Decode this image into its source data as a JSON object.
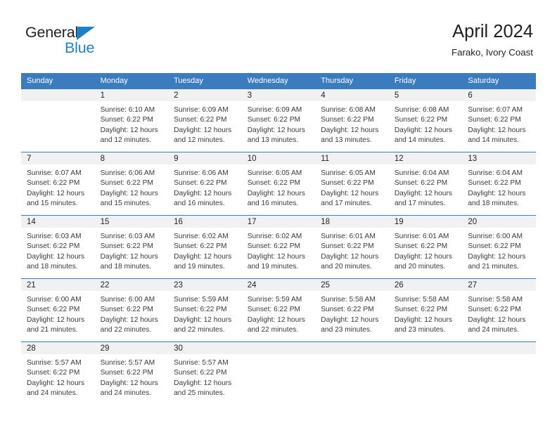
{
  "logo": {
    "word_dark": "General",
    "word_blue": "Blue",
    "triangle_color": "#1f7fc4"
  },
  "header": {
    "title": "April 2024",
    "subtitle": "Farako, Ivory Coast"
  },
  "theme": {
    "header_blue": "#3b7cbf",
    "daynum_band": "#f1f1f1",
    "text": "#231f20",
    "body_text": "#3a3a3a"
  },
  "calendar": {
    "weekday_headers": [
      "Sunday",
      "Monday",
      "Tuesday",
      "Wednesday",
      "Thursday",
      "Friday",
      "Saturday"
    ],
    "weeks": [
      [
        {
          "day": "",
          "lines": [
            "",
            "",
            "",
            ""
          ]
        },
        {
          "day": "1",
          "lines": [
            "Sunrise: 6:10 AM",
            "Sunset: 6:22 PM",
            "Daylight: 12 hours",
            "and 12 minutes."
          ]
        },
        {
          "day": "2",
          "lines": [
            "Sunrise: 6:09 AM",
            "Sunset: 6:22 PM",
            "Daylight: 12 hours",
            "and 12 minutes."
          ]
        },
        {
          "day": "3",
          "lines": [
            "Sunrise: 6:09 AM",
            "Sunset: 6:22 PM",
            "Daylight: 12 hours",
            "and 13 minutes."
          ]
        },
        {
          "day": "4",
          "lines": [
            "Sunrise: 6:08 AM",
            "Sunset: 6:22 PM",
            "Daylight: 12 hours",
            "and 13 minutes."
          ]
        },
        {
          "day": "5",
          "lines": [
            "Sunrise: 6:08 AM",
            "Sunset: 6:22 PM",
            "Daylight: 12 hours",
            "and 14 minutes."
          ]
        },
        {
          "day": "6",
          "lines": [
            "Sunrise: 6:07 AM",
            "Sunset: 6:22 PM",
            "Daylight: 12 hours",
            "and 14 minutes."
          ]
        }
      ],
      [
        {
          "day": "7",
          "lines": [
            "Sunrise: 6:07 AM",
            "Sunset: 6:22 PM",
            "Daylight: 12 hours",
            "and 15 minutes."
          ]
        },
        {
          "day": "8",
          "lines": [
            "Sunrise: 6:06 AM",
            "Sunset: 6:22 PM",
            "Daylight: 12 hours",
            "and 15 minutes."
          ]
        },
        {
          "day": "9",
          "lines": [
            "Sunrise: 6:06 AM",
            "Sunset: 6:22 PM",
            "Daylight: 12 hours",
            "and 16 minutes."
          ]
        },
        {
          "day": "10",
          "lines": [
            "Sunrise: 6:05 AM",
            "Sunset: 6:22 PM",
            "Daylight: 12 hours",
            "and 16 minutes."
          ]
        },
        {
          "day": "11",
          "lines": [
            "Sunrise: 6:05 AM",
            "Sunset: 6:22 PM",
            "Daylight: 12 hours",
            "and 17 minutes."
          ]
        },
        {
          "day": "12",
          "lines": [
            "Sunrise: 6:04 AM",
            "Sunset: 6:22 PM",
            "Daylight: 12 hours",
            "and 17 minutes."
          ]
        },
        {
          "day": "13",
          "lines": [
            "Sunrise: 6:04 AM",
            "Sunset: 6:22 PM",
            "Daylight: 12 hours",
            "and 18 minutes."
          ]
        }
      ],
      [
        {
          "day": "14",
          "lines": [
            "Sunrise: 6:03 AM",
            "Sunset: 6:22 PM",
            "Daylight: 12 hours",
            "and 18 minutes."
          ]
        },
        {
          "day": "15",
          "lines": [
            "Sunrise: 6:03 AM",
            "Sunset: 6:22 PM",
            "Daylight: 12 hours",
            "and 18 minutes."
          ]
        },
        {
          "day": "16",
          "lines": [
            "Sunrise: 6:02 AM",
            "Sunset: 6:22 PM",
            "Daylight: 12 hours",
            "and 19 minutes."
          ]
        },
        {
          "day": "17",
          "lines": [
            "Sunrise: 6:02 AM",
            "Sunset: 6:22 PM",
            "Daylight: 12 hours",
            "and 19 minutes."
          ]
        },
        {
          "day": "18",
          "lines": [
            "Sunrise: 6:01 AM",
            "Sunset: 6:22 PM",
            "Daylight: 12 hours",
            "and 20 minutes."
          ]
        },
        {
          "day": "19",
          "lines": [
            "Sunrise: 6:01 AM",
            "Sunset: 6:22 PM",
            "Daylight: 12 hours",
            "and 20 minutes."
          ]
        },
        {
          "day": "20",
          "lines": [
            "Sunrise: 6:00 AM",
            "Sunset: 6:22 PM",
            "Daylight: 12 hours",
            "and 21 minutes."
          ]
        }
      ],
      [
        {
          "day": "21",
          "lines": [
            "Sunrise: 6:00 AM",
            "Sunset: 6:22 PM",
            "Daylight: 12 hours",
            "and 21 minutes."
          ]
        },
        {
          "day": "22",
          "lines": [
            "Sunrise: 6:00 AM",
            "Sunset: 6:22 PM",
            "Daylight: 12 hours",
            "and 22 minutes."
          ]
        },
        {
          "day": "23",
          "lines": [
            "Sunrise: 5:59 AM",
            "Sunset: 6:22 PM",
            "Daylight: 12 hours",
            "and 22 minutes."
          ]
        },
        {
          "day": "24",
          "lines": [
            "Sunrise: 5:59 AM",
            "Sunset: 6:22 PM",
            "Daylight: 12 hours",
            "and 22 minutes."
          ]
        },
        {
          "day": "25",
          "lines": [
            "Sunrise: 5:58 AM",
            "Sunset: 6:22 PM",
            "Daylight: 12 hours",
            "and 23 minutes."
          ]
        },
        {
          "day": "26",
          "lines": [
            "Sunrise: 5:58 AM",
            "Sunset: 6:22 PM",
            "Daylight: 12 hours",
            "and 23 minutes."
          ]
        },
        {
          "day": "27",
          "lines": [
            "Sunrise: 5:58 AM",
            "Sunset: 6:22 PM",
            "Daylight: 12 hours",
            "and 24 minutes."
          ]
        }
      ],
      [
        {
          "day": "28",
          "lines": [
            "Sunrise: 5:57 AM",
            "Sunset: 6:22 PM",
            "Daylight: 12 hours",
            "and 24 minutes."
          ]
        },
        {
          "day": "29",
          "lines": [
            "Sunrise: 5:57 AM",
            "Sunset: 6:22 PM",
            "Daylight: 12 hours",
            "and 24 minutes."
          ]
        },
        {
          "day": "30",
          "lines": [
            "Sunrise: 5:57 AM",
            "Sunset: 6:22 PM",
            "Daylight: 12 hours",
            "and 25 minutes."
          ]
        },
        {
          "day": "",
          "lines": [
            "",
            "",
            "",
            ""
          ]
        },
        {
          "day": "",
          "lines": [
            "",
            "",
            "",
            ""
          ]
        },
        {
          "day": "",
          "lines": [
            "",
            "",
            "",
            ""
          ]
        },
        {
          "day": "",
          "lines": [
            "",
            "",
            "",
            ""
          ]
        }
      ]
    ]
  }
}
